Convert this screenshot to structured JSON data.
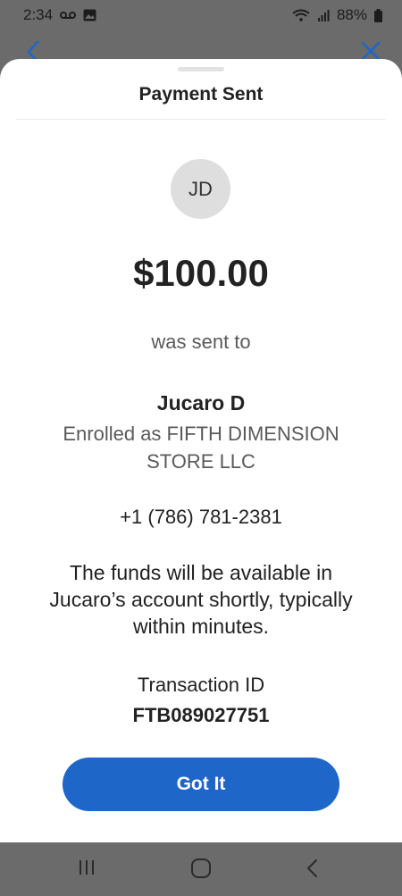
{
  "status_bar": {
    "time": "2:34",
    "battery": "88%"
  },
  "sheet": {
    "title": "Payment Sent",
    "avatar_initials": "JD",
    "amount": "$100.00",
    "sent_to_label": "was sent to",
    "recipient_name": "Jucaro D",
    "enrolled_line1": "Enrolled as FIFTH DIMENSION",
    "enrolled_line2": "STORE LLC",
    "phone": "+1 (786) 781-2381",
    "funds_line1": "The funds will be available in",
    "funds_line2": "Jucaro’s account shortly, typically",
    "funds_line3": "within minutes.",
    "transaction_label": "Transaction ID",
    "transaction_id": "FTB089027751",
    "button_label": "Got It"
  },
  "icons": {
    "back": "chevron-left-icon",
    "close": "close-icon",
    "nav_recents": "recents-icon",
    "nav_home": "home-icon",
    "nav_back": "nav-back-icon"
  },
  "colors": {
    "primary_button": "#1f66c9",
    "backdrop": "#6b6b6b",
    "accent_icon": "#1f66c9"
  }
}
